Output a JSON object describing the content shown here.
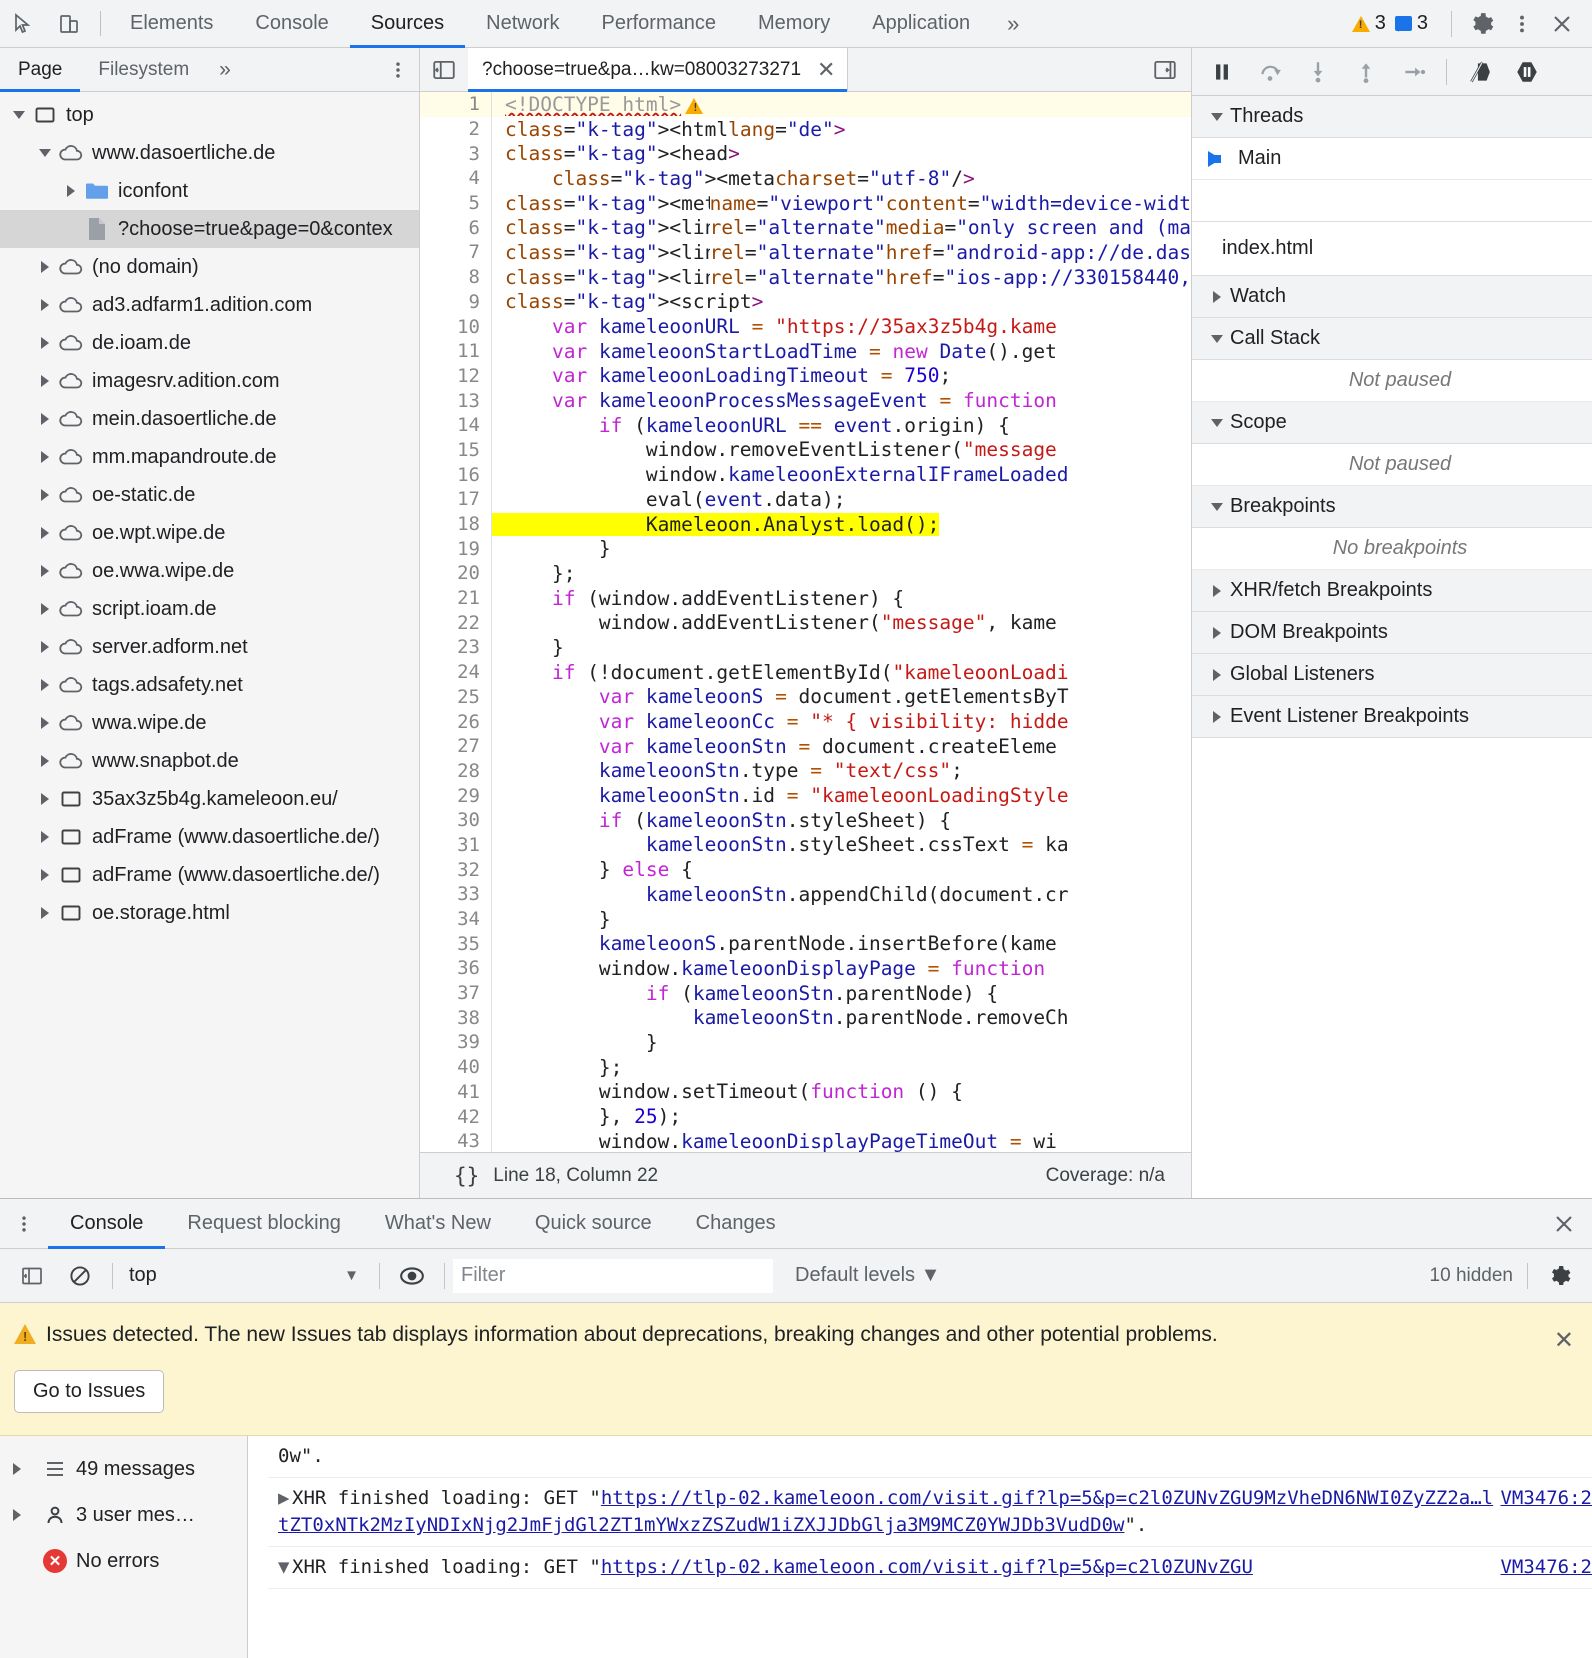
{
  "topbar": {
    "inspect_icon": "inspect-cursor-icon",
    "device_icon": "device-toolbar-icon",
    "tabs": [
      {
        "label": "Elements",
        "selected": false
      },
      {
        "label": "Console",
        "selected": false
      },
      {
        "label": "Sources",
        "selected": true
      },
      {
        "label": "Network",
        "selected": false
      },
      {
        "label": "Performance",
        "selected": false
      },
      {
        "label": "Memory",
        "selected": false
      },
      {
        "label": "Application",
        "selected": false
      }
    ],
    "more_label": "»",
    "warning_count": "3",
    "message_count": "3",
    "settings_icon": "gear-icon",
    "menu_icon": "kebab-menu-icon",
    "close_icon": "close-icon"
  },
  "navigator": {
    "tabs": [
      {
        "label": "Page",
        "selected": true
      },
      {
        "label": "Filesystem",
        "selected": false
      }
    ],
    "more_label": "»",
    "menu_icon": "kebab-menu-icon",
    "tree": [
      {
        "label": "top",
        "icon": "frame-icon",
        "depth": 0,
        "expanded": true,
        "selected": false
      },
      {
        "label": "www.dasoertliche.de",
        "icon": "cloud-icon",
        "depth": 1,
        "expanded": true,
        "selected": false
      },
      {
        "label": "iconfont",
        "icon": "folder-icon",
        "depth": 2,
        "expanded": false,
        "selected": false
      },
      {
        "label": "?choose=true&page=0&contex",
        "icon": "file-icon",
        "depth": 2,
        "expanded": null,
        "selected": true
      },
      {
        "label": "(no domain)",
        "icon": "cloud-icon",
        "depth": 1,
        "expanded": false,
        "selected": false
      },
      {
        "label": "ad3.adfarm1.adition.com",
        "icon": "cloud-icon",
        "depth": 1,
        "expanded": false,
        "selected": false
      },
      {
        "label": "de.ioam.de",
        "icon": "cloud-icon",
        "depth": 1,
        "expanded": false,
        "selected": false
      },
      {
        "label": "imagesrv.adition.com",
        "icon": "cloud-icon",
        "depth": 1,
        "expanded": false,
        "selected": false
      },
      {
        "label": "mein.dasoertliche.de",
        "icon": "cloud-icon",
        "depth": 1,
        "expanded": false,
        "selected": false
      },
      {
        "label": "mm.mapandroute.de",
        "icon": "cloud-icon",
        "depth": 1,
        "expanded": false,
        "selected": false
      },
      {
        "label": "oe-static.de",
        "icon": "cloud-icon",
        "depth": 1,
        "expanded": false,
        "selected": false
      },
      {
        "label": "oe.wpt.wipe.de",
        "icon": "cloud-icon",
        "depth": 1,
        "expanded": false,
        "selected": false
      },
      {
        "label": "oe.wwa.wipe.de",
        "icon": "cloud-icon",
        "depth": 1,
        "expanded": false,
        "selected": false
      },
      {
        "label": "script.ioam.de",
        "icon": "cloud-icon",
        "depth": 1,
        "expanded": false,
        "selected": false
      },
      {
        "label": "server.adform.net",
        "icon": "cloud-icon",
        "depth": 1,
        "expanded": false,
        "selected": false
      },
      {
        "label": "tags.adsafety.net",
        "icon": "cloud-icon",
        "depth": 1,
        "expanded": false,
        "selected": false
      },
      {
        "label": "wwa.wipe.de",
        "icon": "cloud-icon",
        "depth": 1,
        "expanded": false,
        "selected": false
      },
      {
        "label": "www.snapbot.de",
        "icon": "cloud-icon",
        "depth": 1,
        "expanded": false,
        "selected": false
      },
      {
        "label": "35ax3z5b4g.kameleoon.eu/",
        "icon": "frame-icon",
        "depth": 1,
        "expanded": false,
        "selected": false
      },
      {
        "label": "adFrame (www.dasoertliche.de/)",
        "icon": "frame-icon",
        "depth": 1,
        "expanded": false,
        "selected": false
      },
      {
        "label": "adFrame (www.dasoertliche.de/)",
        "icon": "frame-icon",
        "depth": 1,
        "expanded": false,
        "selected": false
      },
      {
        "label": "oe.storage.html",
        "icon": "frame-icon",
        "depth": 1,
        "expanded": false,
        "selected": false
      }
    ]
  },
  "editor": {
    "sidebar_toggle_icon": "show-navigator-icon",
    "tab_title": "?choose=true&pa…kw=08003273271",
    "tab_close_icon": "close-icon",
    "right_toggle_icon": "show-debugger-icon",
    "status": {
      "format_icon": "{}",
      "position": "Line 18, Column 22",
      "coverage": "Coverage: n/a"
    },
    "lines": [
      {
        "n": "1",
        "cur": true,
        "hl": false
      },
      {
        "n": "2",
        "cur": false,
        "hl": false
      },
      {
        "n": "3",
        "cur": false,
        "hl": false
      },
      {
        "n": "4",
        "cur": false,
        "hl": false
      },
      {
        "n": "5",
        "cur": false,
        "hl": false
      },
      {
        "n": "6",
        "cur": false,
        "hl": false
      },
      {
        "n": "7",
        "cur": false,
        "hl": false
      },
      {
        "n": "8",
        "cur": false,
        "hl": false
      },
      {
        "n": "9",
        "cur": false,
        "hl": false
      },
      {
        "n": "10",
        "cur": false,
        "hl": false
      },
      {
        "n": "11",
        "cur": false,
        "hl": false
      },
      {
        "n": "12",
        "cur": false,
        "hl": false
      },
      {
        "n": "13",
        "cur": false,
        "hl": false
      },
      {
        "n": "14",
        "cur": false,
        "hl": false
      },
      {
        "n": "15",
        "cur": false,
        "hl": false
      },
      {
        "n": "16",
        "cur": false,
        "hl": false
      },
      {
        "n": "17",
        "cur": false,
        "hl": false
      },
      {
        "n": "18",
        "cur": false,
        "hl": true
      },
      {
        "n": "19",
        "cur": false,
        "hl": false
      },
      {
        "n": "20",
        "cur": false,
        "hl": false
      },
      {
        "n": "21",
        "cur": false,
        "hl": false
      },
      {
        "n": "22",
        "cur": false,
        "hl": false
      },
      {
        "n": "23",
        "cur": false,
        "hl": false
      },
      {
        "n": "24",
        "cur": false,
        "hl": false
      },
      {
        "n": "25",
        "cur": false,
        "hl": false
      },
      {
        "n": "26",
        "cur": false,
        "hl": false
      },
      {
        "n": "27",
        "cur": false,
        "hl": false
      },
      {
        "n": "28",
        "cur": false,
        "hl": false
      },
      {
        "n": "29",
        "cur": false,
        "hl": false
      },
      {
        "n": "30",
        "cur": false,
        "hl": false
      },
      {
        "n": "31",
        "cur": false,
        "hl": false
      },
      {
        "n": "32",
        "cur": false,
        "hl": false
      },
      {
        "n": "33",
        "cur": false,
        "hl": false
      },
      {
        "n": "34",
        "cur": false,
        "hl": false
      },
      {
        "n": "35",
        "cur": false,
        "hl": false
      },
      {
        "n": "36",
        "cur": false,
        "hl": false
      },
      {
        "n": "37",
        "cur": false,
        "hl": false
      },
      {
        "n": "38",
        "cur": false,
        "hl": false
      },
      {
        "n": "39",
        "cur": false,
        "hl": false
      },
      {
        "n": "40",
        "cur": false,
        "hl": false
      },
      {
        "n": "41",
        "cur": false,
        "hl": false
      },
      {
        "n": "42",
        "cur": false,
        "hl": false
      },
      {
        "n": "43",
        "cur": false,
        "hl": false
      }
    ],
    "source_text": [
      "<!DOCTYPE html>",
      "<html lang=\"de\">",
      "<head>",
      "    <meta charset=\"utf-8\"/>",
      "<meta name=\"viewport\" content=\"width=device-widt",
      "<link rel=\"alternate\" media=\"only screen and (ma",
      "<link rel=\"alternate\" href=\"android-app://de.das",
      "<link rel=\"alternate\" href=\"ios-app://330158440,",
      "<script>",
      "    var kameleoonURL = \"https://35ax3z5b4g.kame",
      "    var kameleoonStartLoadTime = new Date().get",
      "    var kameleoonLoadingTimeout = 750;",
      "    var kameleoonProcessMessageEvent = function",
      "        if (kameleoonURL == event.origin) {",
      "            window.removeEventListener(\"message",
      "            window.kameleoonExternalIFrameLoaded",
      "            eval(event.data);",
      "            Kameleoon.Analyst.load();",
      "        }",
      "    };",
      "    if (window.addEventListener) {",
      "        window.addEventListener(\"message\", kame",
      "    }",
      "    if (!document.getElementById(\"kameleoonLoadi",
      "        var kameleoonS = document.getElementsByT",
      "        var kameleoonCc = \"* { visibility: hidde",
      "        var kameleoonStn = document.createEleme",
      "        kameleoonStn.type = \"text/css\";",
      "        kameleoonStn.id = \"kameleoonLoadingStyle",
      "        if (kameleoonStn.styleSheet) {",
      "            kameleoonStn.styleSheet.cssText = ka",
      "        } else {",
      "            kameleoonStn.appendChild(document.cr",
      "        }",
      "        kameleoonS.parentNode.insertBefore(kame",
      "        window.kameleoonDisplayPage = function",
      "            if (kameleoonStn.parentNode) {",
      "                kameleoonStn.parentNode.removeCh",
      "            }",
      "        };",
      "        window.setTimeout(function () {",
      "        }, 25);",
      "        window.kameleoonDisplayPageTimeOut = wi"
    ]
  },
  "debugger": {
    "toolbar": {
      "pause_icon": "pause-icon",
      "step_over_icon": "step-over-icon",
      "step_into_icon": "step-into-icon",
      "step_out_icon": "step-out-icon",
      "step_icon": "step-icon",
      "deactivate_breakpoints_icon": "deactivate-breakpoints-icon",
      "pause_on_exceptions_icon": "pause-on-exceptions-icon"
    },
    "sections": {
      "threads": {
        "label": "Threads",
        "expanded": true,
        "main": "Main"
      },
      "file": "index.html",
      "watch": {
        "label": "Watch",
        "expanded": false
      },
      "call_stack": {
        "label": "Call Stack",
        "expanded": true,
        "empty": "Not paused"
      },
      "scope": {
        "label": "Scope",
        "expanded": true,
        "empty": "Not paused"
      },
      "breakpoints": {
        "label": "Breakpoints",
        "expanded": true,
        "empty": "No breakpoints"
      },
      "xhr": {
        "label": "XHR/fetch Breakpoints",
        "expanded": false
      },
      "dom": {
        "label": "DOM Breakpoints",
        "expanded": false
      },
      "global": {
        "label": "Global Listeners",
        "expanded": false
      },
      "event_listener": {
        "label": "Event Listener Breakpoints",
        "expanded": false
      }
    }
  },
  "drawer": {
    "menu_icon": "kebab-menu-icon",
    "tabs": [
      {
        "label": "Console",
        "selected": true
      },
      {
        "label": "Request blocking",
        "selected": false
      },
      {
        "label": "What's New",
        "selected": false
      },
      {
        "label": "Quick source",
        "selected": false
      },
      {
        "label": "Changes",
        "selected": false
      }
    ],
    "close_icon": "close-icon",
    "filter_bar": {
      "sidebar_icon": "show-console-sidebar-icon",
      "clear_icon": "clear-console-icon",
      "context": "top",
      "context_caret": "▼",
      "eye_icon": "live-expression-icon",
      "filter_placeholder": "Filter",
      "levels": "Default levels",
      "levels_caret": "▼",
      "hidden_count": "10 hidden",
      "settings_icon": "gear-icon"
    },
    "issues_banner": {
      "warning_icon": "warning-triangle-icon",
      "text": "Issues detected. The new Issues tab displays information about deprecations, breaking changes and other potential problems.",
      "button": "Go to Issues",
      "close_icon": "close-icon"
    },
    "sidebar": [
      {
        "label": "49 messages",
        "icon": "list-icon",
        "expandable": true
      },
      {
        "label": "3 user mes…",
        "icon": "user-icon",
        "expandable": true
      },
      {
        "label": "No errors",
        "icon": "error-circle-icon",
        "expandable": false
      }
    ],
    "messages": [
      {
        "truncated_tail": "0w\".",
        "disclosure": "",
        "prefix": "",
        "url": "",
        "vm": ""
      },
      {
        "disclosure": "▶",
        "prefix": "XHR finished loading: GET \"",
        "url": "https://tlp-02.kameleoon.com/visit.gif?lp=5&p=c2l0ZUNvZGU9MzVheDN6NWI0ZyZZ2a…ltZT0xNTk2MzIyNDIxNjg2JmFjdGl2ZT1mYWxzZSZudW1iZXJJDbGlja3M9MCZ0YWJDb3VudD0w",
        "suffix": "\".",
        "vm": "VM3476:2"
      },
      {
        "disclosure": "▼",
        "prefix": "XHR finished loading: GET \"",
        "url": "https://tlp-02.kameleoon.com/visit.gif?lp=5&p=c2l0ZUNvZGU",
        "suffix": "",
        "vm": "VM3476:2"
      }
    ]
  }
}
